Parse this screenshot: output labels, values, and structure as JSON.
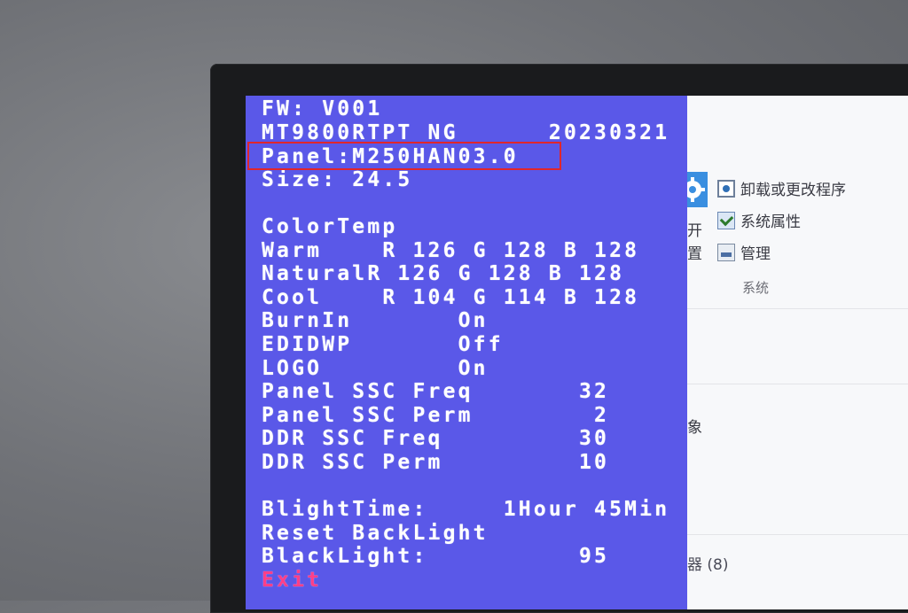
{
  "osd": {
    "lines": [
      "FW: V001",
      "MT9800RTPT NG      20230321",
      "Panel:M250HAN03.0",
      "Size: 24.5",
      "",
      "ColorTemp",
      "Warm    R 126 G 128 B 128",
      "NaturalR 126 G 128 B 128",
      "Cool    R 104 G 114 B 128",
      "BurnIn       On",
      "EDIDWP       Off",
      "LOGO         On",
      "Panel SSC Freq       32",
      "Panel SSC Perm        2",
      "DDR SSC Freq         30",
      "DDR SSC Perm         10",
      "",
      "BlightTime:     1Hour 45Min",
      "Reset BackLight",
      "BlackLight:          95"
    ],
    "exit_label": "Exit",
    "colors": {
      "background": "#5a58e8",
      "text": "#ffffff",
      "exit": "#ff3f88",
      "highlight": "#e0262b"
    }
  },
  "windows": {
    "uninstall_label": "卸载或更改程序",
    "system_properties_label": "系统属性",
    "manage_label": "管理",
    "group_label": "系统",
    "frag_open": "开",
    "frag_settings": "置",
    "frag_object": "象",
    "frag_devices": "器 (8)"
  }
}
